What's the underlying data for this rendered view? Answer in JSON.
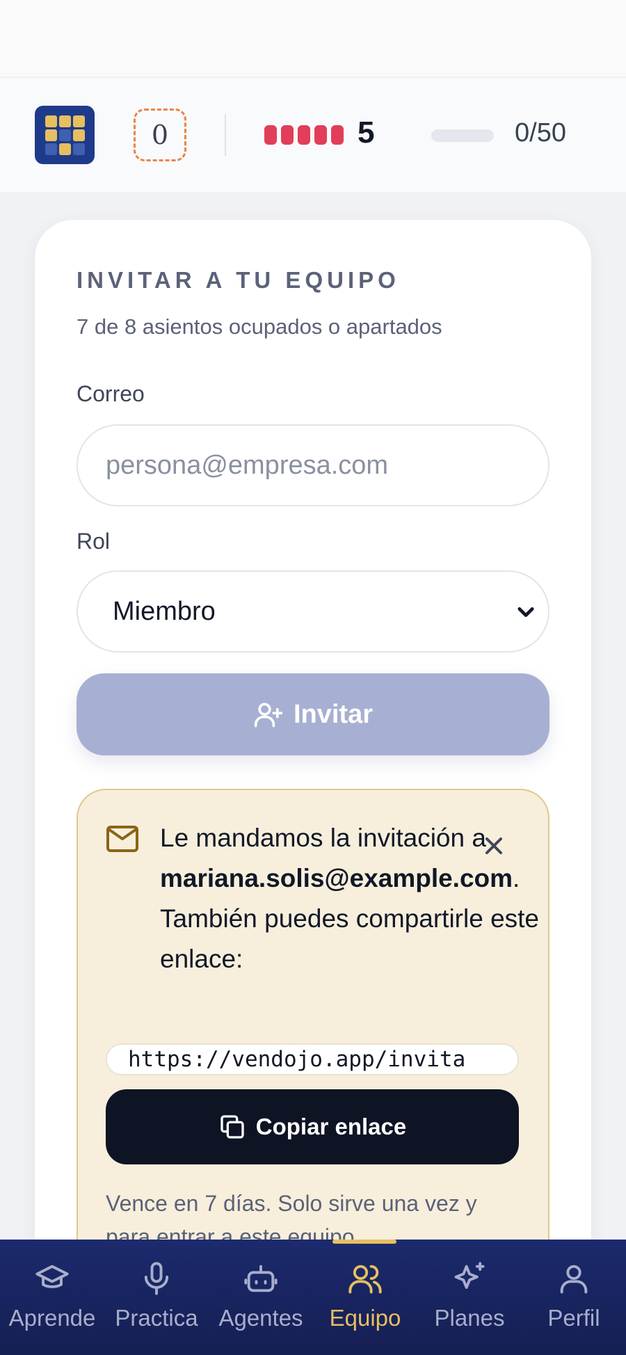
{
  "header": {
    "gems": "0",
    "lives_count": "5",
    "xp": "0/50",
    "xp_progress": 0
  },
  "invite": {
    "title": "INVITAR A TU EQUIPO",
    "seats": "7 de 8 asientos ocupados o apartados",
    "email_label": "Correo",
    "email_placeholder": "persona@empresa.com",
    "email_value": "",
    "role_label": "Rol",
    "role_value": "Miembro",
    "submit_label": "Invitar"
  },
  "notice": {
    "text_before": "Le mandamos la invitación a ",
    "email": "mariana.solis@example.com",
    "text_after": ". También puedes compartirle este enlace:",
    "link": "https://vendojo.app/invita",
    "copy_label": "Copiar enlace",
    "expiry": "Vence en 7 días. Solo sirve una vez y para entrar a este equipo."
  },
  "nav": {
    "items": [
      {
        "label": "Aprende",
        "icon": "graduation-cap-icon"
      },
      {
        "label": "Practica",
        "icon": "microphone-icon"
      },
      {
        "label": "Agentes",
        "icon": "robot-icon"
      },
      {
        "label": "Equipo",
        "icon": "users-icon"
      },
      {
        "label": "Planes",
        "icon": "sparkles-icon"
      },
      {
        "label": "Perfil",
        "icon": "user-icon"
      }
    ],
    "active": "Equipo"
  },
  "colors": {
    "accent": "#e7bf61",
    "navy": "#1e3a8a",
    "heart": "#e23d5a",
    "button_disabled": "#a7b0d2",
    "notice_bg": "#f7efdc"
  }
}
